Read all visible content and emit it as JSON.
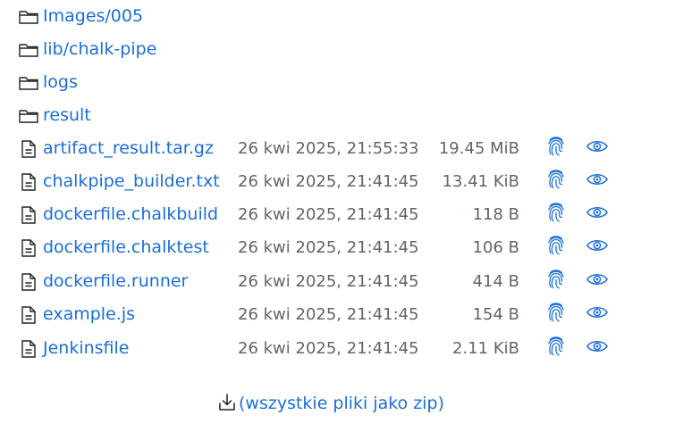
{
  "entries": [
    {
      "type": "folder",
      "name": "Images/005",
      "date": "",
      "size": ""
    },
    {
      "type": "folder",
      "name": "lib/chalk-pipe",
      "date": "",
      "size": ""
    },
    {
      "type": "folder",
      "name": "logs",
      "date": "",
      "size": ""
    },
    {
      "type": "folder",
      "name": "result",
      "date": "",
      "size": ""
    },
    {
      "type": "file",
      "name": "artifact_result.tar.gz",
      "date": "26 kwi 2025, 21:55:33",
      "size": "19.45 MiB"
    },
    {
      "type": "file",
      "name": "chalkpipe_builder.txt",
      "date": "26 kwi 2025, 21:41:45",
      "size": "13.41 KiB"
    },
    {
      "type": "file",
      "name": "dockerfile.chalkbuild",
      "date": "26 kwi 2025, 21:41:45",
      "size": "118 B"
    },
    {
      "type": "file",
      "name": "dockerfile.chalktest",
      "date": "26 kwi 2025, 21:41:45",
      "size": "106 B"
    },
    {
      "type": "file",
      "name": "dockerfile.runner",
      "date": "26 kwi 2025, 21:41:45",
      "size": "414 B"
    },
    {
      "type": "file",
      "name": "example.js",
      "date": "26 kwi 2025, 21:41:45",
      "size": "154 B"
    },
    {
      "type": "file",
      "name": "Jenkinsfile",
      "date": "26 kwi 2025, 21:41:45",
      "size": "2.11 KiB"
    }
  ],
  "zip": {
    "label": "(wszystkie pliki jako zip)",
    "icon": "download-icon"
  },
  "icons": {
    "folder": "folder-icon",
    "file": "file-icon",
    "fingerprint": "fingerprint-icon",
    "view": "eye-icon"
  },
  "colors": {
    "link": "#1a6ed8",
    "muted": "#5f646d"
  }
}
